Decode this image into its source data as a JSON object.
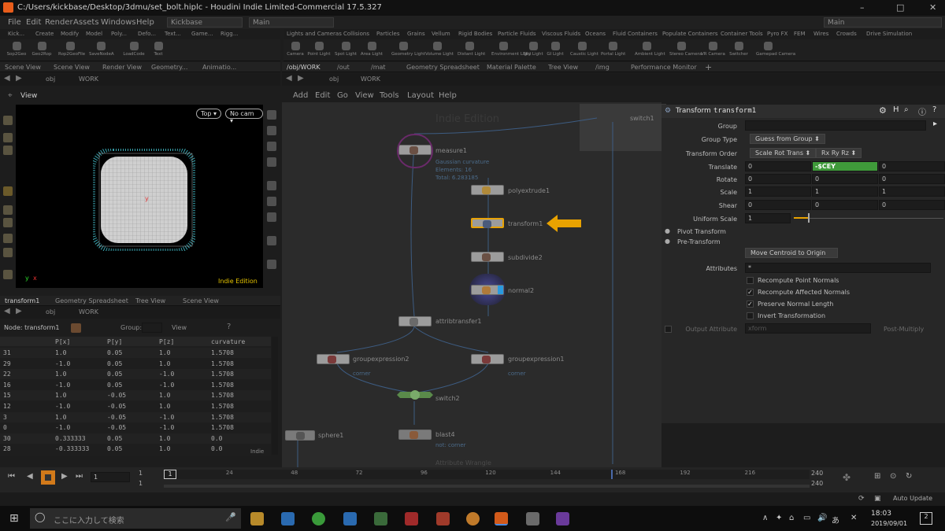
{
  "titlebar": {
    "text": "C:/Users/kickbase/Desktop/3dmu/set_bolt.hiplc - Houdini Indie Limited-Commercial 17.5.327",
    "minimize": "–",
    "maximize": "□",
    "close": "✕"
  },
  "menu": {
    "items": [
      "File",
      "Edit",
      "Render",
      "Assets",
      "Windows",
      "Help"
    ],
    "desktop": "Kickbase",
    "context": "Main",
    "context_right": "Main"
  },
  "shelf_left": {
    "tabs": [
      "Kick...",
      "Create",
      "Modify",
      "Model",
      "Poly...",
      "Defo...",
      "Text...",
      "Game...",
      "Rigg..."
    ],
    "tools": [
      "Sop2Geo",
      "Geo2Rop",
      "Rop2GeoFile",
      "SaveNodeA",
      "LoadCode",
      "Text"
    ]
  },
  "shelf_right": {
    "tabs": [
      "Lights and Cameras",
      "Collisions",
      "Particles",
      "Grains",
      "Vellum",
      "Rigid Bodies",
      "Particle Fluids",
      "Viscous Fluids",
      "Oceans",
      "Fluid Containers",
      "Populate Containers",
      "Container Tools",
      "Pyro FX",
      "FEM",
      "Wires",
      "Crowds",
      "Drive Simulation"
    ],
    "tools": [
      "Camera",
      "Point Light",
      "Spot Light",
      "Area Light",
      "Geometry Light",
      "Volume Light",
      "Distant Light",
      "Environment Light",
      "Sky Light",
      "GI Light",
      "Caustic Light",
      "Portal Light",
      "Ambient Light",
      "Stereo Camera",
      "VR Camera",
      "Switcher",
      "Gamepad Camera"
    ]
  },
  "scene_tabs": [
    "Scene View",
    "Scene View",
    "Render View",
    "Geometry...",
    "Animatio..."
  ],
  "scene_path": {
    "obj": "obj",
    "net": "WORK"
  },
  "viewport": {
    "title": "View",
    "view_btn": "Top ▾",
    "cam_btn": "No cam ▾",
    "edition": "Indie Edition",
    "axis_y": "y",
    "axis_x": "x"
  },
  "network_tabs": [
    "/obj/WORK",
    "/out",
    "/mat",
    "Geometry Spreadsheet",
    "Material Palette",
    "Tree View",
    "/img",
    "Performance Monitor"
  ],
  "network_path": {
    "obj": "obj",
    "net": "WORK"
  },
  "network_menu": [
    "Add",
    "Edit",
    "Go",
    "View",
    "Tools",
    "Layout",
    "Help"
  ],
  "network": {
    "watermark": "Indie Edition",
    "switch_ghost": "switch1",
    "nodes": [
      {
        "name": "measure1"
      },
      {
        "name": "polyextrude1"
      },
      {
        "name": "transform1"
      },
      {
        "name": "subdivide2"
      },
      {
        "name": "normal2"
      },
      {
        "name": "attribtransfer1"
      },
      {
        "name": "groupexpression2",
        "sub": "corner"
      },
      {
        "name": "groupexpression1",
        "sub": "corner"
      },
      {
        "name": "switch2"
      },
      {
        "name": "sphere1"
      },
      {
        "name": "blast4",
        "sub": "not: corner"
      }
    ],
    "measure_info": [
      "Gaussian curvature",
      "Elements: 16",
      "Total: 6.283185"
    ],
    "partial_label": "Attribute Wrangle"
  },
  "params": {
    "type": "Transform",
    "name": "transform1",
    "group_label": "Group",
    "group_value": "",
    "group_type_label": "Group Type",
    "group_type": "Guess from Group",
    "order_label": "Transform Order",
    "order1": "Scale Rot Trans",
    "order2": "Rx Ry Rz",
    "translate_label": "Translate",
    "translate": [
      "0",
      "-$CEY",
      "0"
    ],
    "rotate_label": "Rotate",
    "rotate": [
      "0",
      "0",
      "0"
    ],
    "scale_label": "Scale",
    "scale": [
      "1",
      "1",
      "1"
    ],
    "shear_label": "Shear",
    "shear": [
      "0",
      "0",
      "0"
    ],
    "uniform_label": "Uniform Scale",
    "uniform": "1",
    "pivot": "Pivot Transform",
    "pre": "Pre-Transform",
    "centroid_btn": "Move Centroid to Origin",
    "attr_label": "Attributes",
    "attr_value": "*",
    "checks": [
      {
        "label": "Recompute Point Normals",
        "checked": false
      },
      {
        "label": "Recompute Affected Normals",
        "checked": true
      },
      {
        "label": "Preserve Normal Length",
        "checked": true
      },
      {
        "label": "Invert Transformation",
        "checked": false
      }
    ],
    "output_label": "Output Attribute",
    "output_value": "xform",
    "output_mode": "Post-Multiply"
  },
  "sheet_tabs": [
    "transform1",
    "Geometry Spreadsheet",
    "Tree View",
    "Scene View"
  ],
  "sheet": {
    "node_label": "Node: transform1",
    "group_label": "Group:",
    "view_label": "View",
    "columns": [
      "",
      "P[x]",
      "P[y]",
      "P[z]",
      "curvature"
    ],
    "rows": [
      [
        "31",
        "1.0",
        "0.05",
        "1.0",
        "1.5708"
      ],
      [
        "29",
        "-1.0",
        "0.05",
        "1.0",
        "1.5708"
      ],
      [
        "22",
        "1.0",
        "0.05",
        "-1.0",
        "1.5708"
      ],
      [
        "16",
        "-1.0",
        "0.05",
        "-1.0",
        "1.5708"
      ],
      [
        "15",
        "1.0",
        "-0.05",
        "1.0",
        "1.5708"
      ],
      [
        "12",
        "-1.0",
        "-0.05",
        "1.0",
        "1.5708"
      ],
      [
        "3",
        "1.0",
        "-0.05",
        "-1.0",
        "1.5708"
      ],
      [
        "0",
        "-1.0",
        "-0.05",
        "-1.0",
        "1.5708"
      ],
      [
        "30",
        "0.333333",
        "0.05",
        "1.0",
        "0.0"
      ],
      [
        "28",
        "-0.333333",
        "0.05",
        "1.0",
        "0.0"
      ]
    ],
    "footer": "Indie"
  },
  "timeline": {
    "frame": "1",
    "start": "1",
    "start2": "1",
    "ticks": [
      "1",
      "24",
      "48",
      "72",
      "96",
      "120",
      "144",
      "168",
      "192",
      "216"
    ],
    "end": "240",
    "end2": "240",
    "auto_update": "Auto Update"
  },
  "taskbar": {
    "search": "ここに入力して検索",
    "time": "18:03",
    "date": "2019/09/01",
    "notif": "2"
  },
  "colors": {
    "accent": "#e8a200",
    "translate_green": "#3f9a3a"
  }
}
